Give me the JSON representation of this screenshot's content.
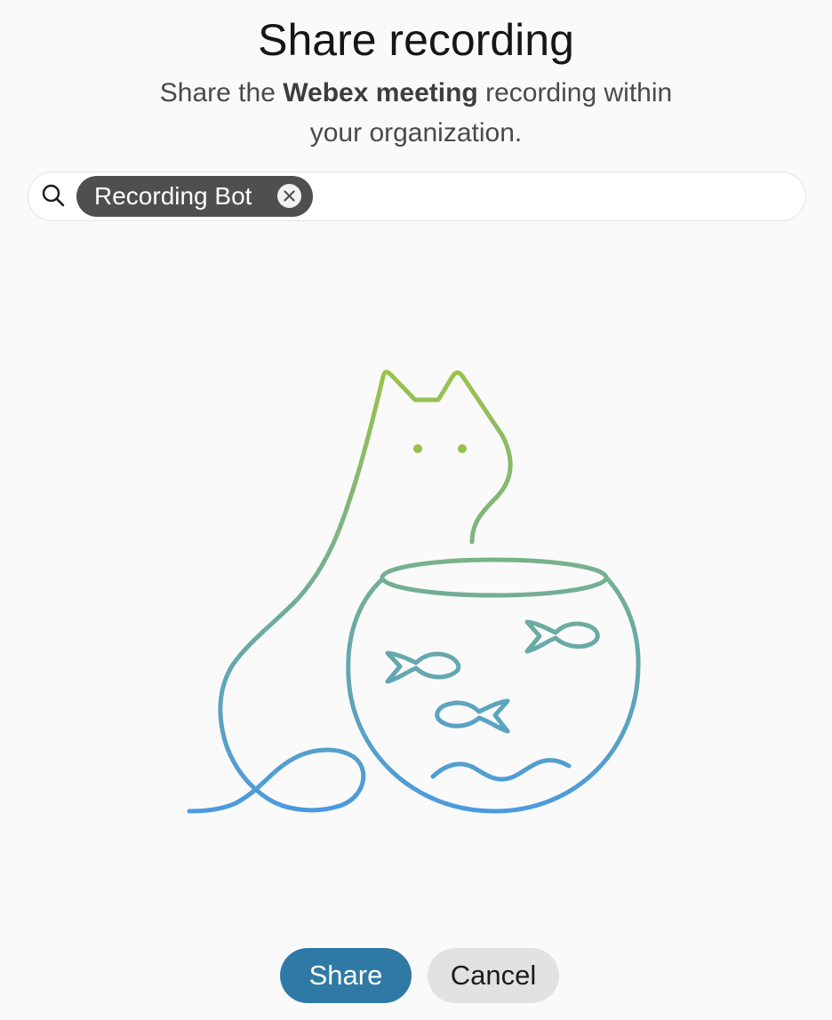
{
  "dialog": {
    "title": "Share recording",
    "subtitle_prefix": "Share the ",
    "subtitle_bold": "Webex meeting",
    "subtitle_suffix": " recording within your organization."
  },
  "search": {
    "icon": "search-icon",
    "value": "",
    "chips": [
      {
        "label": "Recording Bot",
        "remove_icon": "close-icon"
      }
    ]
  },
  "illustration": {
    "name": "cat-and-fishbowl-illustration",
    "gradient_colors": [
      "#9bc34a",
      "#4a9ae0"
    ]
  },
  "actions": {
    "share_label": "Share",
    "cancel_label": "Cancel"
  },
  "colors": {
    "primary": "#2f7aa4",
    "chip": "#4f4f4f",
    "secondary": "#e2e2e2"
  }
}
